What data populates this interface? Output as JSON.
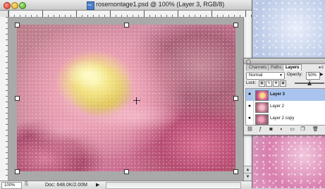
{
  "window": {
    "title": "rosemontage1.psd @ 100% (Layer 3, RGB/8)"
  },
  "status": {
    "zoom": "100%",
    "doc_info": "Doc: 648.0K/2.00M",
    "menu_arrow": "▶"
  },
  "palette": {
    "tabs": [
      {
        "label": "Channels",
        "active": false
      },
      {
        "label": "Paths",
        "active": false
      },
      {
        "label": "Layers",
        "active": true
      }
    ],
    "menu_glyph": "▸≡",
    "blend_mode": "Normal",
    "opacity_label": "Opacity:",
    "opacity_value": "50%",
    "opacity_fraction": 0.5,
    "lock_label": "Lock:",
    "lock_icons": [
      "transparency-lock-icon",
      "brush-lock-icon",
      "move-lock-icon",
      "all-lock-icon"
    ],
    "layers": [
      {
        "name": "Layer 3",
        "visible": true,
        "selected": true,
        "thumbnail": "rose-thumb-icon"
      },
      {
        "name": "Layer 2",
        "visible": true,
        "selected": false,
        "thumbnail": "rose-thumb-icon"
      },
      {
        "name": "Layer 2 copy",
        "visible": true,
        "selected": false,
        "thumbnail": "rose-thumb-icon"
      }
    ],
    "footer_icons": [
      "link-icon",
      "fx-icon",
      "mask-icon",
      "adjustment-icon",
      "group-icon",
      "new-layer-icon",
      "trash-icon"
    ]
  },
  "colors": {
    "selection": "#a9c5ef",
    "window_chrome": "#c9c9c9",
    "canvas_bg": "#a9a9a9"
  }
}
